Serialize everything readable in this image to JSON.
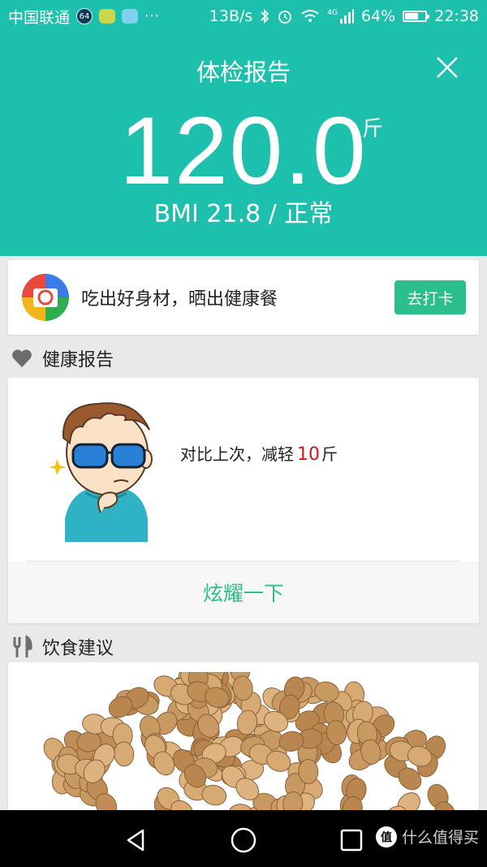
{
  "status_bar": {
    "carrier": "中国联通",
    "badge": "64",
    "dots": "···",
    "speed": "13B/s",
    "network": "4G",
    "battery": "64%",
    "battery_level": 0.64,
    "time": "22:38"
  },
  "header": {
    "title": "体检报告",
    "weight": "120.0",
    "unit": "斤",
    "bmi": "BMI 21.8 / 正常"
  },
  "banner": {
    "text": "吃出好身材，晒出健康餐",
    "button": "去打卡"
  },
  "health_section": {
    "title": "健康报告",
    "compare_prefix": "对比上次，减轻",
    "compare_value": "10",
    "compare_unit": "斤",
    "share_button": "炫耀一下"
  },
  "diet_section": {
    "title": "饮食建议"
  },
  "watermark": {
    "badge": "值",
    "text": "什么值得买"
  },
  "colors": {
    "teal": "#1dbfad",
    "green": "#2bbf8b",
    "red": "#c8171e"
  }
}
